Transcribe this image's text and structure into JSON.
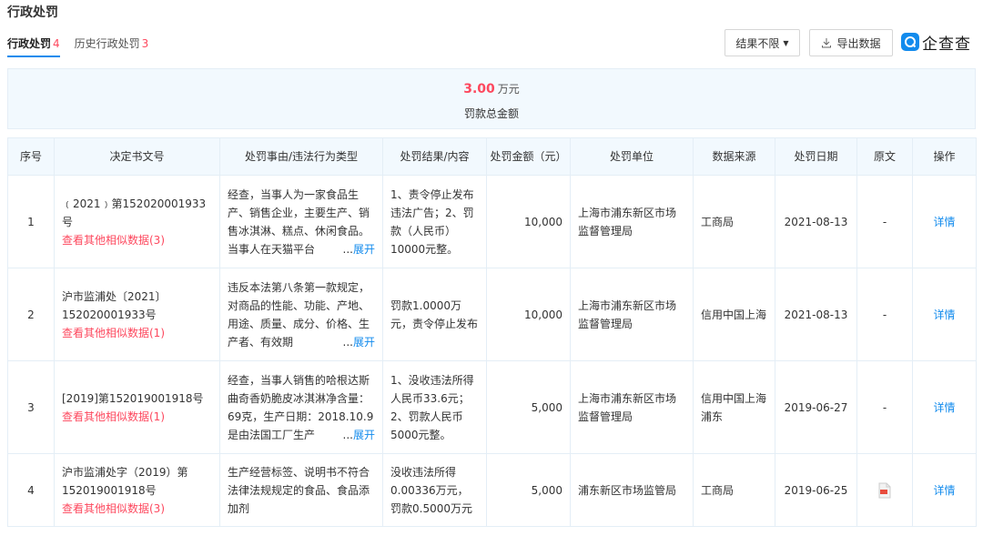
{
  "page_title": "行政处罚",
  "tabs": [
    {
      "label": "行政处罚",
      "count": "4"
    },
    {
      "label": "历史行政处罚",
      "count": "3"
    }
  ],
  "toolbar": {
    "filter_label": "结果不限",
    "export_label": "导出数据"
  },
  "brand": {
    "name": "企查查"
  },
  "summary": {
    "value": "3.00",
    "unit": "万元",
    "label": "罚款总金额"
  },
  "table": {
    "headers": [
      "序号",
      "决定书文号",
      "处罚事由/违法行为类型",
      "处罚结果/内容",
      "处罚金额（元）",
      "处罚单位",
      "数据来源",
      "处罚日期",
      "原文",
      "操作"
    ],
    "rows": [
      {
        "index": "1",
        "doc_no": "﹙2021﹚第152020001933号",
        "similar": "查看其他相似数据(3)",
        "reason": "经查，当事人为一家食品生产、销售企业，主要生产、销售冰淇淋、糕点、休闲食品。当事人在天猫平台",
        "reason_more": "...",
        "reason_expand": "展开",
        "result": "1、责令停止发布违法广告；2、罚款（人民币）10000元整。",
        "amount": "10,000",
        "authority": "上海市浦东新区市场监督管理局",
        "source": "工商局",
        "date": "2021-08-13",
        "original": "-",
        "action": "详情"
      },
      {
        "index": "2",
        "doc_no": "沪市监浦处〔2021〕152020001933号",
        "similar": "查看其他相似数据(1)",
        "reason": "违反本法第八条第一款规定，对商品的性能、功能、产地、用途、质量、成分、价格、生产者、有效期",
        "reason_more": "...",
        "reason_expand": "展开",
        "result": "罚款1.0000万元，责令停止发布",
        "amount": "10,000",
        "authority": "上海市浦东新区市场监督管理局",
        "source": "信用中国上海",
        "date": "2021-08-13",
        "original": "-",
        "action": "详情"
      },
      {
        "index": "3",
        "doc_no": "[2019]第152019001918号",
        "similar": "查看其他相似数据(1)",
        "reason": "经查，当事人销售的哈根达斯曲奇香奶脆皮冰淇淋净含量：69克，生产日期：2018.10.9是由法国工厂生产",
        "reason_more": "...",
        "reason_expand": "展开",
        "result": "1、没收违法所得人民币33.6元；2、罚款人民币5000元整。",
        "amount": "5,000",
        "authority": "上海市浦东新区市场监督管理局",
        "source": "信用中国上海浦东",
        "date": "2019-06-27",
        "original": "-",
        "action": "详情"
      },
      {
        "index": "4",
        "doc_no": "沪市监浦处字（2019）第152019001918号",
        "similar": "查看其他相似数据(3)",
        "reason": "生产经营标签、说明书不符合法律法规规定的食品、食品添加剂",
        "result": "没收违法所得0.00336万元，罚款0.5000万元",
        "amount": "5,000",
        "authority": "浦东新区市场监管局",
        "source": "工商局",
        "date": "2019-06-25",
        "original_icon": "pdf-icon",
        "action": "详情"
      }
    ]
  },
  "colors": {
    "accent": "#128bed",
    "highlight": "#fd485e",
    "header_bg": "#f2f9fe",
    "border": "#e4eef6"
  }
}
